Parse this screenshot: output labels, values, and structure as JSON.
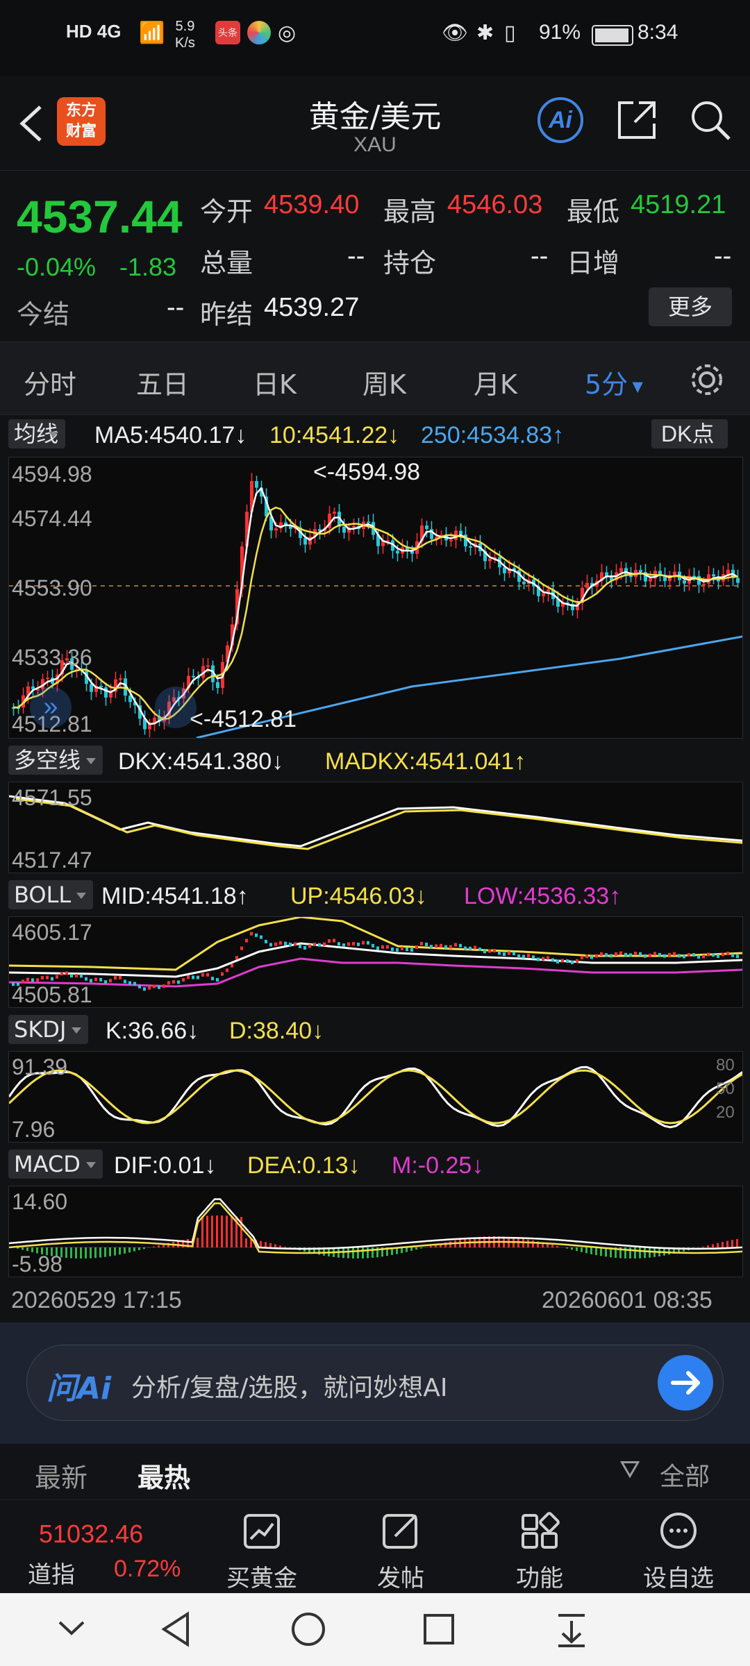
{
  "status_bar": {
    "network": "HD 4G",
    "speed_value": "5.9",
    "speed_unit": "K/s",
    "battery": "91%",
    "time": "8:34"
  },
  "header": {
    "title": "黄金/美元",
    "subtitle": "XAU",
    "logo_line1": "东方",
    "logo_line2": "财富",
    "ai_label": "Ai"
  },
  "quote": {
    "price": "4537.44",
    "change_pct": "-0.04%",
    "change": "-1.83",
    "open_label": "今开",
    "open": "4539.40",
    "high_label": "最高",
    "high": "4546.03",
    "low_label": "最低",
    "low": "4519.21",
    "volume_label": "总量",
    "volume": "--",
    "position_label": "持仓",
    "position": "--",
    "daily_inc_label": "日增",
    "daily_inc": "--",
    "settle_label": "今结",
    "settle": "--",
    "prev_settle_label": "昨结",
    "prev_settle": "4539.27",
    "more_label": "更多"
  },
  "tabs": [
    "分时",
    "五日",
    "日K",
    "周K",
    "月K",
    "5分"
  ],
  "active_tab": "5分",
  "ma": {
    "button": "均线",
    "ma5": "MA5:4540.17↓",
    "ma10": "10:4541.22↓",
    "ma250": "250:4534.83↑",
    "dk_button": "DK点"
  },
  "main_chart": {
    "y_labels": [
      "4594.98",
      "4574.44",
      "4553.90",
      "4533.36",
      "4512.81"
    ],
    "high_marker": "<-4594.98",
    "low_marker": "<-4512.81"
  },
  "dkx": {
    "button": "多空线",
    "dkx": "DKX:4541.380↓",
    "madkx": "MADKX:4541.041↑",
    "y_labels": [
      "4571.55",
      "4517.47"
    ]
  },
  "boll": {
    "button": "BOLL",
    "mid": "MID:4541.18↑",
    "up": "UP:4546.03↓",
    "low": "LOW:4536.33↑",
    "y_labels": [
      "4605.17",
      "4505.81"
    ]
  },
  "skdj": {
    "button": "SKDJ",
    "k": "K:36.66↓",
    "d": "D:38.40↓",
    "y_labels": [
      "91.39",
      "7.96"
    ],
    "right_labels": [
      "80",
      "50",
      "20"
    ]
  },
  "macd": {
    "button": "MACD",
    "dif": "DIF:0.01↓",
    "dea": "DEA:0.13↓",
    "m": "M:-0.25↓",
    "y_labels": [
      "14.60",
      "-5.98"
    ]
  },
  "time_axis": {
    "start": "20260529 17:15",
    "end": "20260601 08:35"
  },
  "ai_bar": {
    "logo": "问Ai",
    "placeholder": "分析/复盘/选股，就问妙想AI"
  },
  "feed_tabs": {
    "latest": "最新",
    "hot": "最热",
    "all": "全部"
  },
  "bottom_bar": {
    "index_value": "51032.46",
    "index_name": "道指",
    "index_change": "0.72%",
    "items": [
      "买黄金",
      "发帖",
      "功能",
      "设自选"
    ]
  },
  "colors": {
    "up": "#ff3b3b",
    "down": "#23c93a",
    "ma5": "#ffffff",
    "ma10": "#f5e04a",
    "ma250": "#4aa8f0",
    "boll_low": "#e03cd0",
    "accent": "#3f86e6"
  }
}
